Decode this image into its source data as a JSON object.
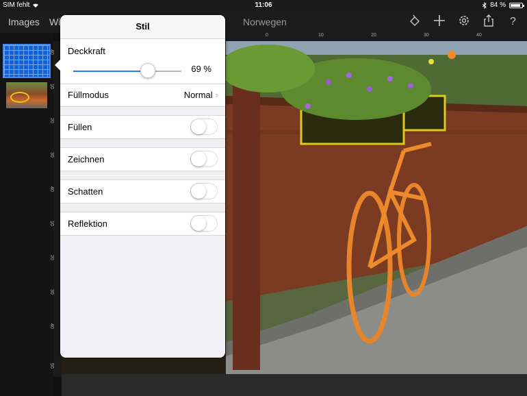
{
  "status": {
    "carrier": "SIM fehlt",
    "time": "11:06",
    "battery": "84 %"
  },
  "navbar": {
    "images_label": "Images",
    "second_label": "Wi",
    "document_title": "Norwegen",
    "icons": [
      "paint-bucket-icon",
      "plus-icon",
      "gear-icon",
      "share-icon",
      "help-icon"
    ]
  },
  "rulers": {
    "top": [
      "0",
      "10",
      "20",
      "30",
      "40"
    ],
    "left": [
      "40",
      "10",
      "20",
      "30",
      "40",
      "10",
      "20",
      "30",
      "40",
      "50"
    ]
  },
  "popover": {
    "title": "Stil",
    "opacity_label": "Deckkraft",
    "opacity_value": "69 %",
    "opacity_fraction": 0.69,
    "fill_mode_label": "Füllmodus",
    "fill_mode_value": "Normal",
    "toggles": [
      {
        "label": "Füllen",
        "on": false
      },
      {
        "label": "Zeichnen",
        "on": false
      },
      {
        "label": "Schatten",
        "on": false
      },
      {
        "label": "Reflektion",
        "on": false
      }
    ]
  },
  "colors": {
    "accent": "#1f7bff",
    "selection": "#1463d6"
  }
}
